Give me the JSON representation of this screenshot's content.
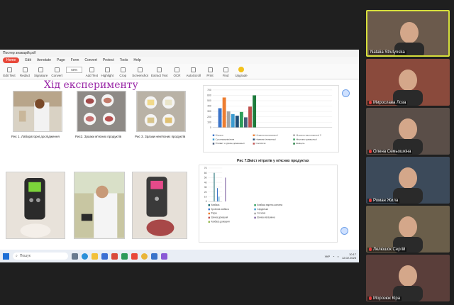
{
  "pdf": {
    "title": "Постер знакарій.pdf",
    "menu": [
      "Home",
      "Edit",
      "Annotate",
      "Page",
      "Form",
      "Convert",
      "Protect",
      "Tools",
      "Help"
    ],
    "ribbon": [
      "Edit Text",
      "Redact",
      "Signature",
      "Convert",
      "Add Text",
      "Highlight",
      "Crop",
      "Screenshot",
      "Extract Text",
      "OCR",
      "AutoScroll",
      "Print",
      "Find",
      "Upgrade"
    ],
    "zoom": "50%",
    "page": "1 / 1",
    "zoom_bottom": "50%"
  },
  "slide": {
    "title": "Хід експерименту",
    "captions": {
      "fig1": "Рис 1. Лабораторні дослідження",
      "fig2": "Рис2. Зразки м'ясних продуктів",
      "fig3": "Рис 3. Зразки нем'ясних продуктів",
      "fig7": "Рис 7.Вміст нітратів у м'ясних продуктах"
    }
  },
  "chart_data": [
    {
      "type": "bar",
      "title": "",
      "categories": [
        "1",
        "2",
        "3",
        "4",
        "5",
        "6",
        "7",
        "8"
      ],
      "ylim": [
        0,
        700
      ],
      "yticks": [
        "0",
        "100",
        "200",
        "300",
        "400",
        "500",
        "600",
        "700"
      ],
      "series": [
        {
          "name": "Нітрати",
          "color": "#3b74c9",
          "values": [
            360,
            0,
            0,
            0,
            0,
            0,
            0,
            0
          ]
        },
        {
          "name": "Нітратно-ватонанньої",
          "color": "#ed7d31",
          "values": [
            560,
            0,
            0,
            0,
            0,
            0,
            0,
            0
          ]
        },
        {
          "name": "Нітратно-вастонанньої 2",
          "color": "#a5a5a5",
          "values": [
            300,
            0,
            0,
            0,
            0,
            0,
            0,
            0
          ]
        },
        {
          "name": "Сушеновалів'яння",
          "color": "#3b9bd0",
          "values": [
            250,
            0,
            0,
            0,
            0,
            0,
            0,
            0
          ]
        },
        {
          "name": "Нижневіт'япнанньої",
          "color": "#1f4e79",
          "values": [
            220,
            0,
            0,
            0,
            0,
            0,
            0,
            0
          ]
        },
        {
          "name": "Нікотино-домашньої",
          "color": "#2e9e5b",
          "values": [
            290,
            0,
            0,
            0,
            0,
            0,
            0,
            0
          ]
        },
        {
          "name": "Нітиват з куркою домашньої",
          "color": "#4a5a7a",
          "values": [
            190,
            0,
            0,
            0,
            0,
            0,
            0,
            0
          ]
        },
        {
          "name": "Сосисочи",
          "color": "#c0504d",
          "values": [
            390,
            0,
            0,
            0,
            0,
            0,
            0,
            0
          ]
        },
        {
          "name": "Шніцель",
          "color": "#1e7b3c",
          "values": [
            600,
            0,
            0,
            0,
            0,
            0,
            0,
            0
          ]
        }
      ]
    },
    {
      "type": "bar",
      "title": "",
      "categories": [
        "1"
      ],
      "ylim": [
        0,
        70
      ],
      "yticks": [
        "0",
        "10",
        "20",
        "30",
        "40",
        "50",
        "60",
        "70"
      ],
      "series": [
        {
          "name": "Ковбаса",
          "color": "#1f6e73",
          "values": [
            60
          ]
        },
        {
          "name": "Ковбаса варено-копчена",
          "color": "#2e9e5b",
          "values": [
            0
          ]
        },
        {
          "name": "Кров'яна ковбаса",
          "color": "#3b74c9",
          "values": [
            28
          ]
        },
        {
          "name": "Сардельки",
          "color": "#3b9bd0",
          "values": [
            10
          ]
        },
        {
          "name": "Фарш",
          "color": "#ed7d31",
          "values": [
            0
          ]
        },
        {
          "name": "Сосиски",
          "color": "#a5a5a5",
          "values": [
            0
          ]
        },
        {
          "name": "Шинка домашня",
          "color": "#c0504d",
          "values": [
            0
          ]
        },
        {
          "name": "Шинка магазинна",
          "color": "#8064a2",
          "values": [
            50
          ]
        },
        {
          "name": "Ковбаса домашня",
          "color": "#9bbb59",
          "values": [
            0
          ]
        }
      ]
    }
  ],
  "taskbar": {
    "search": "Пошук",
    "lang": "УКР",
    "time": "10:17",
    "date": "12.02.2025"
  },
  "participants": [
    {
      "name": "Natalia Strutynska",
      "active": true,
      "muted": false
    },
    {
      "name": "Мирослава Лоза",
      "active": false,
      "muted": true
    },
    {
      "name": "Олена Семьошкіна",
      "active": false,
      "muted": true
    },
    {
      "name": "Роман Жила",
      "active": false,
      "muted": true
    },
    {
      "name": "Лелюшок Сергій",
      "active": false,
      "muted": true
    },
    {
      "name": "Морозюк Кіра",
      "active": false,
      "muted": true
    }
  ]
}
